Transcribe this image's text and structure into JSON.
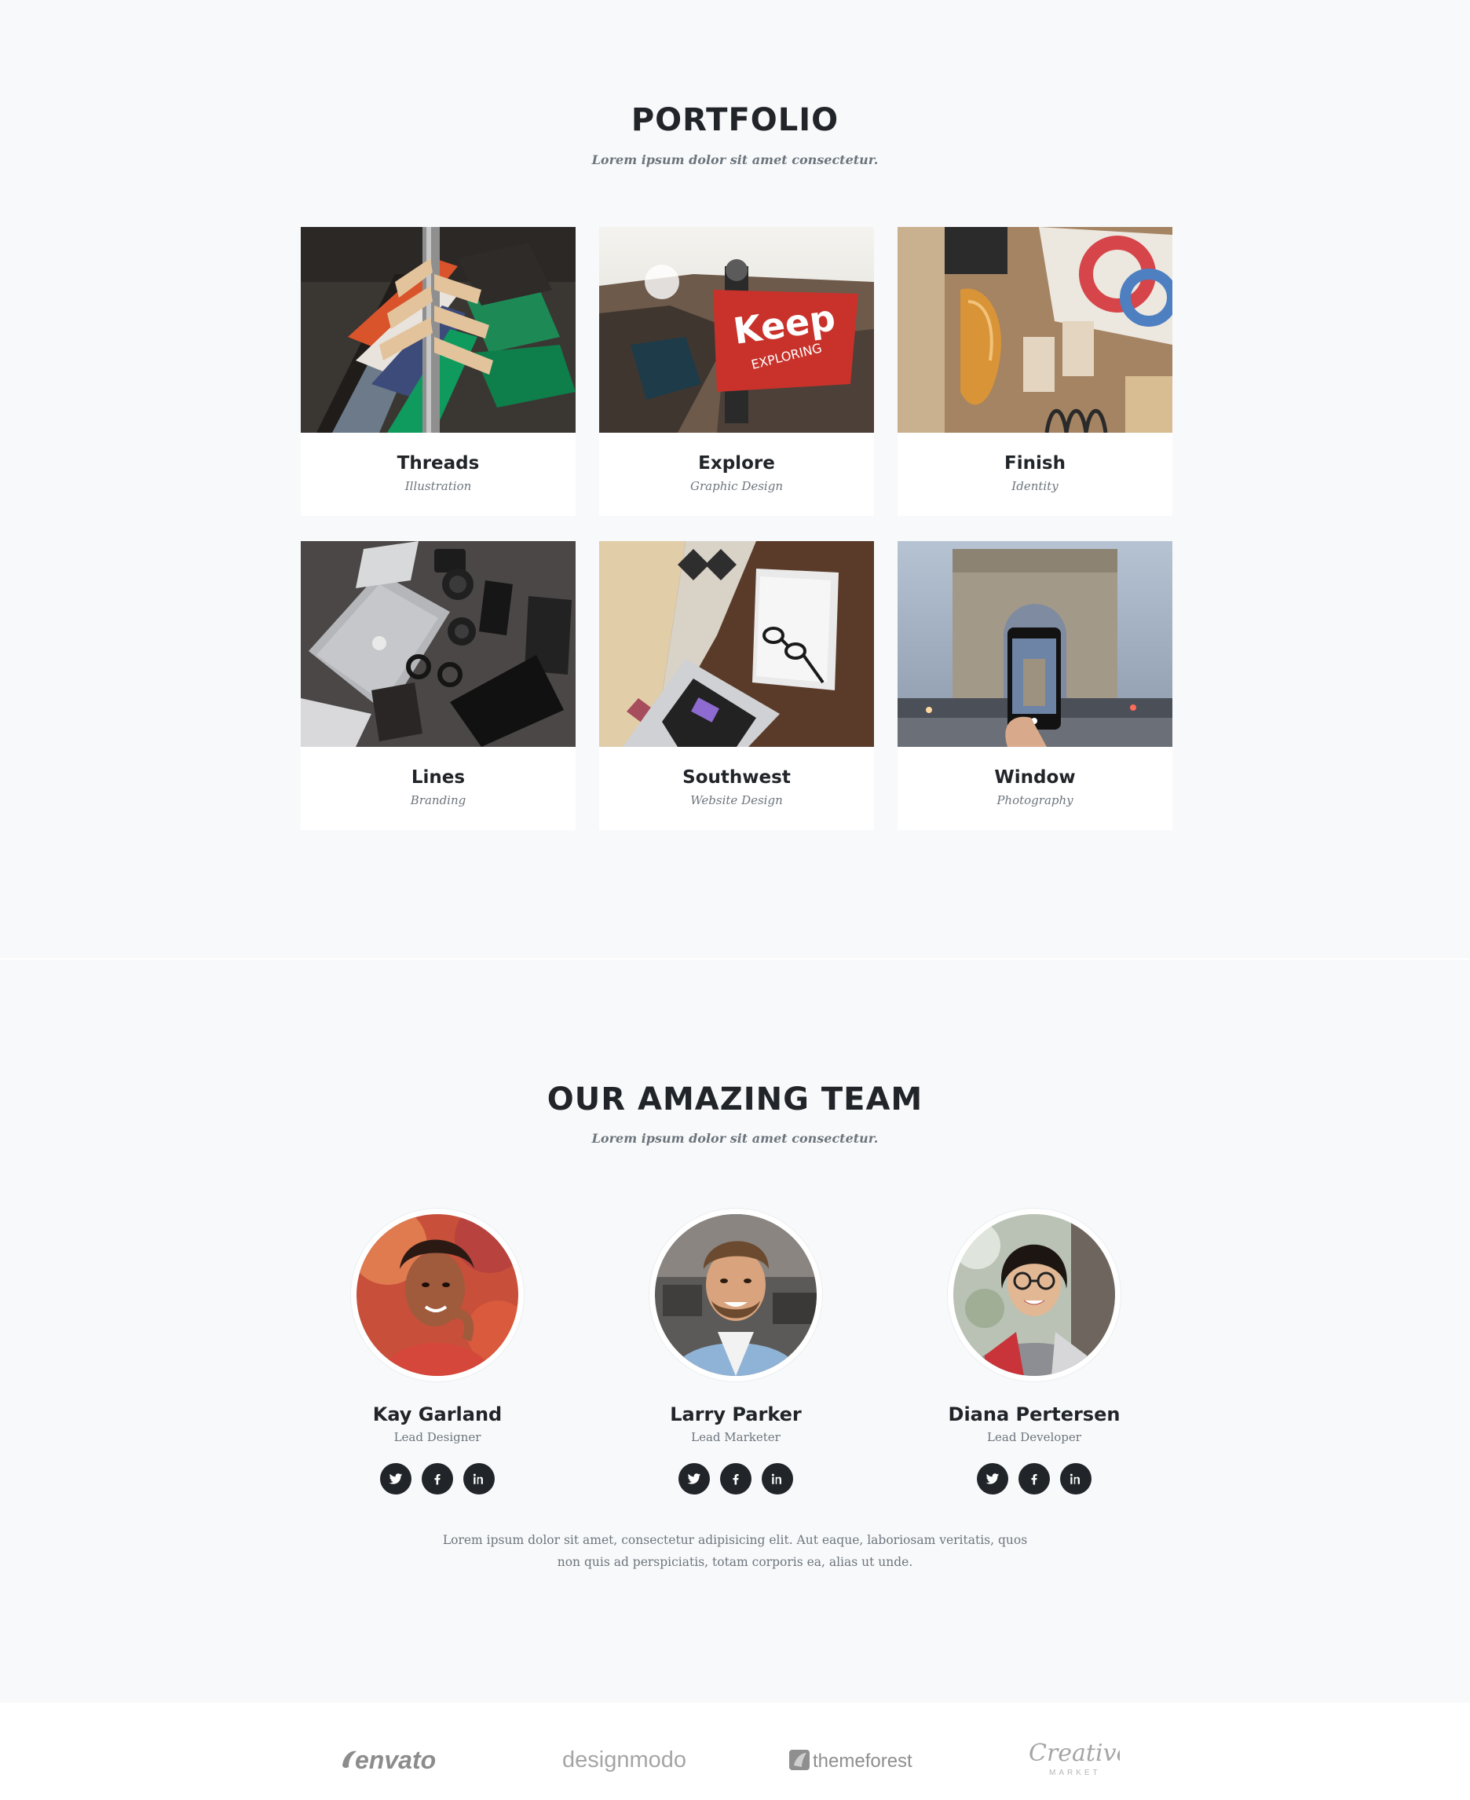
{
  "portfolio": {
    "heading": "PORTFOLIO",
    "subheading": "Lorem ipsum dolor sit amet consectetur.",
    "items": [
      {
        "title": "Threads",
        "category": "Illustration"
      },
      {
        "title": "Explore",
        "category": "Graphic Design"
      },
      {
        "title": "Finish",
        "category": "Identity"
      },
      {
        "title": "Lines",
        "category": "Branding"
      },
      {
        "title": "Southwest",
        "category": "Website Design"
      },
      {
        "title": "Window",
        "category": "Photography"
      }
    ]
  },
  "team": {
    "heading": "OUR AMAZING TEAM",
    "subheading": "Lorem ipsum dolor sit amet consectetur.",
    "members": [
      {
        "name": "Kay Garland",
        "role": "Lead Designer"
      },
      {
        "name": "Larry Parker",
        "role": "Lead Marketer"
      },
      {
        "name": "Diana Pertersen",
        "role": "Lead Developer"
      }
    ],
    "social_icons": [
      "twitter-icon",
      "facebook-icon",
      "linkedin-icon"
    ],
    "text": "Lorem ipsum dolor sit amet, consectetur adipisicing elit. Aut eaque, laboriosam veritatis, quos non quis ad perspiciatis, totam corporis ea, alias ut unde.",
    "avatar_border_color": "#ffffff",
    "social_button_color": "#212529"
  },
  "clients": {
    "logos": [
      {
        "name": "envato",
        "text": "envato"
      },
      {
        "name": "designmodo",
        "text": "designmodo"
      },
      {
        "name": "themeforest",
        "text": "themeforest"
      },
      {
        "name": "creative-market",
        "text": "Creative",
        "subtext": "MARKET"
      }
    ]
  }
}
